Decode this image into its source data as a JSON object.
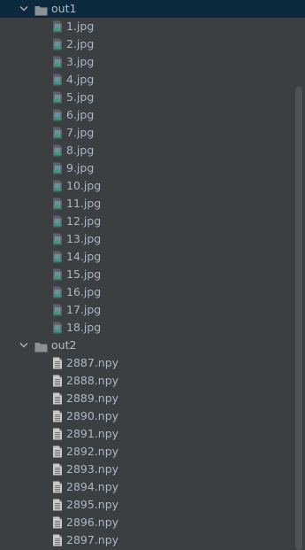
{
  "colors": {
    "background": "#3c3f41",
    "selection": "#0d293e",
    "text": "#a9b7c6",
    "folder_icon": "#8c9194",
    "image_icon": "#6e8fa0",
    "npy_icon": "#c9c9c9",
    "scrollbar_thumb": "#4e5254"
  },
  "folders": [
    {
      "name": "out1",
      "expanded": true,
      "selected": true,
      "icon": "folder-icon",
      "file_icon": "image-file-icon",
      "files": [
        "1.jpg",
        "2.jpg",
        "3.jpg",
        "4.jpg",
        "5.jpg",
        "6.jpg",
        "7.jpg",
        "8.jpg",
        "9.jpg",
        "10.jpg",
        "11.jpg",
        "12.jpg",
        "13.jpg",
        "14.jpg",
        "15.jpg",
        "16.jpg",
        "17.jpg",
        "18.jpg"
      ]
    },
    {
      "name": "out2",
      "expanded": true,
      "selected": false,
      "icon": "folder-icon",
      "file_icon": "text-file-icon",
      "files": [
        "2887.npy",
        "2888.npy",
        "2889.npy",
        "2890.npy",
        "2891.npy",
        "2892.npy",
        "2893.npy",
        "2894.npy",
        "2895.npy",
        "2896.npy",
        "2897.npy"
      ]
    }
  ]
}
